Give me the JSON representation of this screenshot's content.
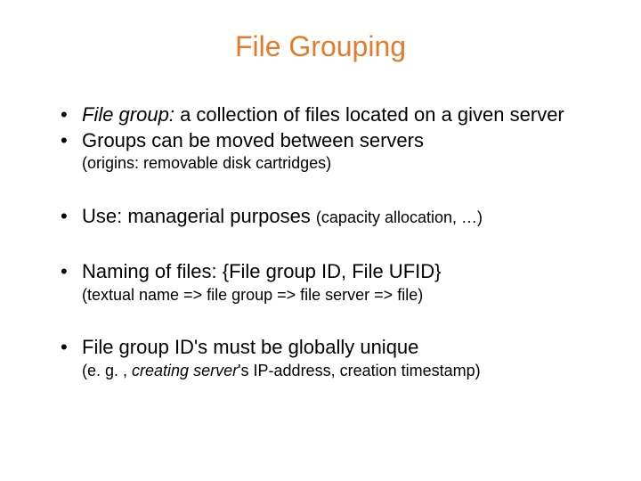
{
  "title": "File Grouping",
  "bullets": {
    "b1_prefix_italic": "File group:",
    "b1_rest": " a collection of files located on a given server",
    "b2": "Groups can be moved between servers",
    "b2_sub": "(origins: removable disk cartridges)",
    "b3_main": "Use: managerial purposes ",
    "b3_paren": "(capacity allocation, …)",
    "b4": "Naming of files: {File group ID, File UFID}",
    "b4_sub": "(textual name => file group => file server => file)",
    "b5": "File group ID's must be globally unique",
    "b5_sub_prefix": "(e. g. , ",
    "b5_sub_italic": "creating server",
    "b5_sub_suffix": "'s IP-address, creation timestamp)"
  }
}
